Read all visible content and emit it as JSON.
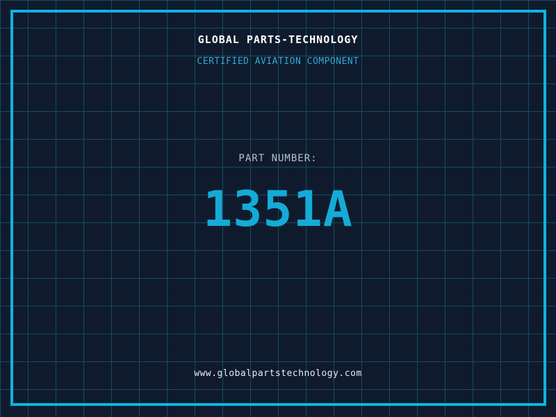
{
  "colors": {
    "bg": "#0f1b2d",
    "grid": "#174a63",
    "frame": "#0fb3e2",
    "title": "#ffffff",
    "tagline": "#2fa9d6",
    "label": "#b6c1c9",
    "number": "#14abd6",
    "url": "#e6ecf0"
  },
  "header": {
    "company_name": "GLOBAL PARTS-TECHNOLOGY",
    "tagline": "CERTIFIED AVIATION COMPONENT"
  },
  "part": {
    "label": "PART NUMBER:",
    "number": "1351A"
  },
  "footer": {
    "website": "www.globalpartstechnology.com"
  }
}
